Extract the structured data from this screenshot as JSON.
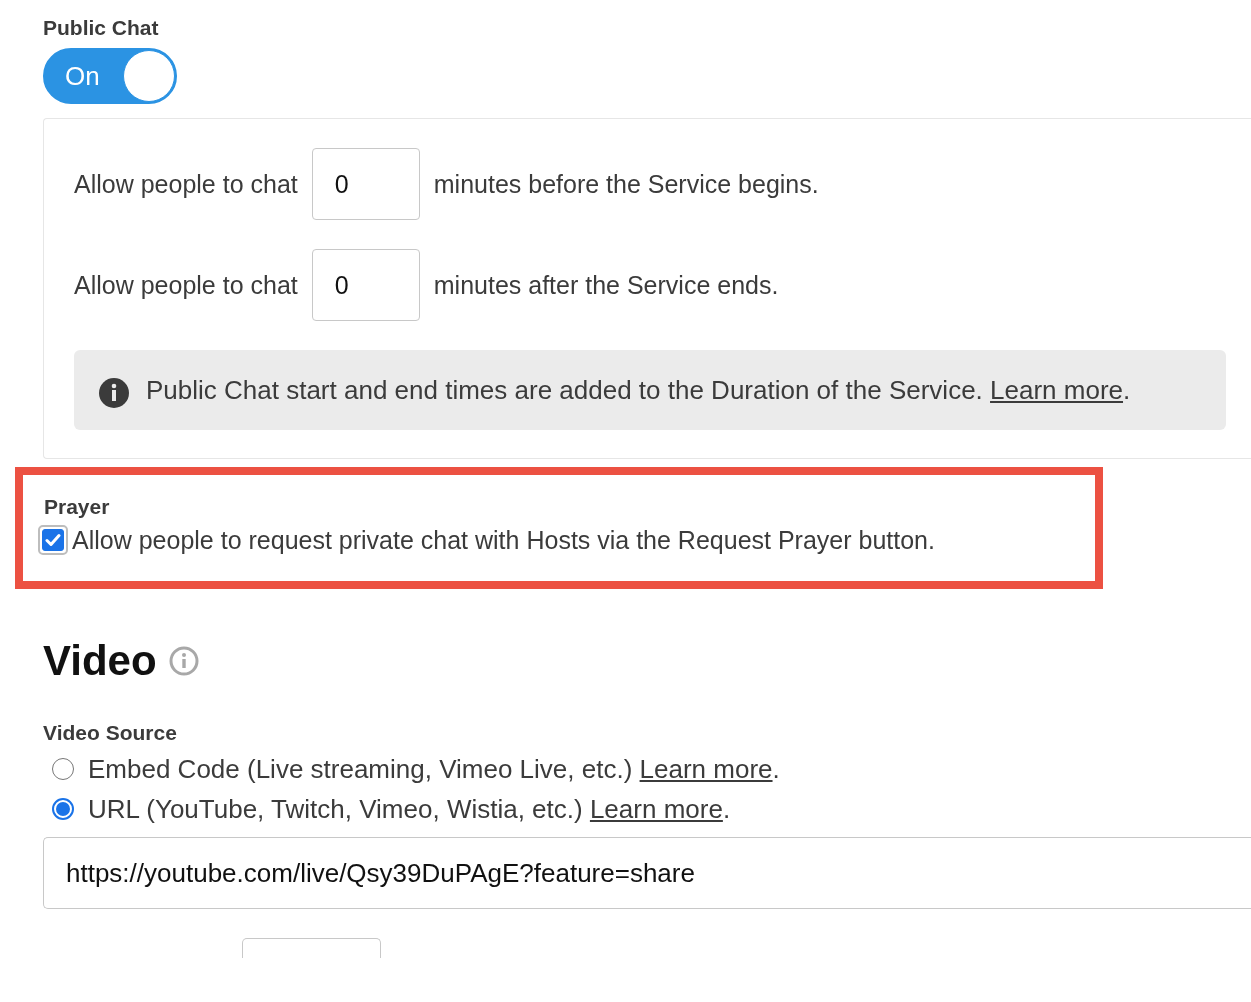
{
  "public_chat": {
    "label": "Public Chat",
    "toggle": {
      "on": true,
      "text": "On"
    },
    "rows": [
      {
        "prefix": "Allow people to chat",
        "value": "0",
        "suffix": "minutes before the Service begins."
      },
      {
        "prefix": "Allow people to chat",
        "value": "0",
        "suffix": "minutes after the Service ends."
      }
    ],
    "notice": {
      "text": "Public Chat start and end times are added to the Duration of the Service.",
      "link": "Learn more",
      "end": "."
    }
  },
  "prayer": {
    "label": "Prayer",
    "checkbox": {
      "checked": true,
      "label": "Allow people to request private chat with Hosts via the Request Prayer button."
    }
  },
  "video": {
    "heading": "Video",
    "source_label": "Video Source",
    "options": [
      {
        "label": "Embed Code (Live streaming, Vimeo Live, etc.)",
        "link": "Learn more",
        "end": ".",
        "selected": false
      },
      {
        "label": "URL (YouTube, Twitch, Vimeo, Wistia, etc.)",
        "link": "Learn more",
        "end": ".",
        "selected": true
      }
    ],
    "url": "https://youtube.com/live/Qsy39DuPAgE?feature=share"
  }
}
